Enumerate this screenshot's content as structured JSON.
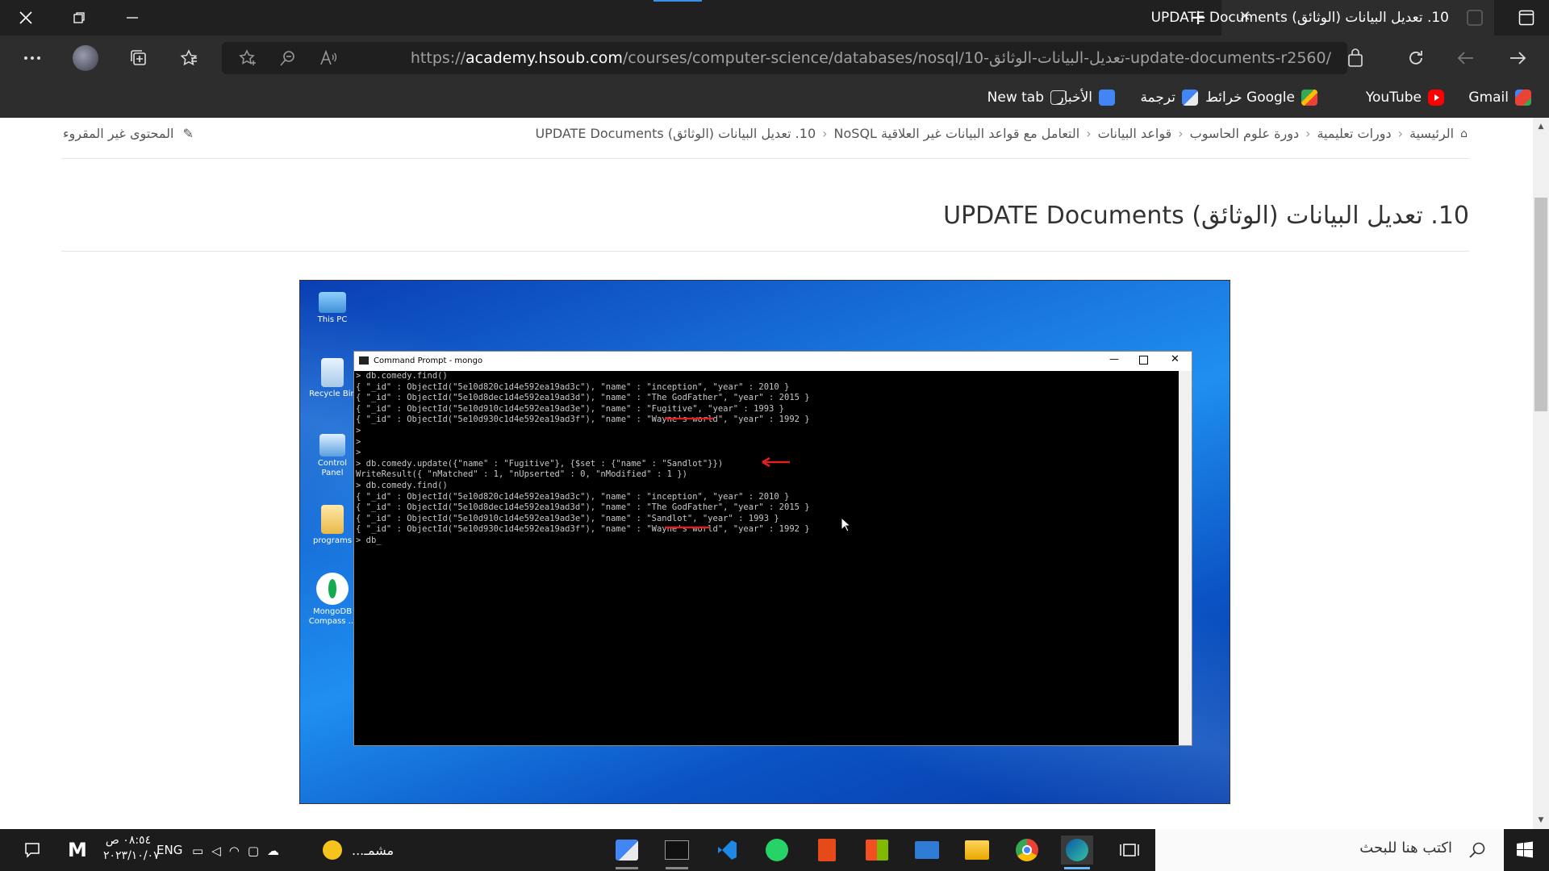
{
  "browser": {
    "tab_title": "10. تعديل البيانات (الوثائق) UPDATE Documents",
    "url_host": "academy.hsoub.com",
    "url_prefix": "https://",
    "url_path": "/courses/computer-science/databases/nosql/10-تعديل-البيانات-الوثائق-update-documents-r2560/",
    "favorites": [
      {
        "label": "Gmail",
        "icon": "gmail-icon",
        "color": "#EA4335"
      },
      {
        "label": "YouTube",
        "icon": "youtube-icon",
        "color": "#FF0000"
      },
      {
        "label": "خرائط Google",
        "icon": "maps-icon",
        "color": "#34A853"
      },
      {
        "label": "ترجمة",
        "icon": "translate-icon",
        "color": "#4285F4"
      },
      {
        "label": "الأخبار",
        "icon": "news-icon",
        "color": "#4285F4"
      },
      {
        "label": "New tab",
        "icon": "newtab-icon",
        "color": "#cccccc"
      }
    ]
  },
  "page": {
    "breadcrumb": [
      "الرئيسية",
      "دورات تعليمية",
      "دورة علوم الحاسوب",
      "قواعد البيانات",
      "التعامل مع قواعد البيانات غير العلاقية NoSQL",
      "10. تعديل البيانات (الوثائق) UPDATE Documents"
    ],
    "unread_label": "المحتوى غير المقروء",
    "heading": "10. تعديل البيانات (الوثائق) UPDATE Documents"
  },
  "screenshot": {
    "desktop_icons": [
      "This PC",
      "Recycle Bin",
      "Control Panel",
      "programs",
      "MongoDB Compass ..."
    ],
    "cmd_title": "Command Prompt - mongo",
    "cmd_lines": [
      "> db.comedy.find()",
      "{ \"_id\" : ObjectId(\"5e10d820c1d4e592ea19ad3c\"), \"name\" : \"inception\", \"year\" : 2010 }",
      "{ \"_id\" : ObjectId(\"5e10d8dec1d4e592ea19ad3d\"), \"name\" : \"The GodFather\", \"year\" : 2015 }",
      "{ \"_id\" : ObjectId(\"5e10d910c1d4e592ea19ad3e\"), \"name\" : \"Fugitive\", \"year\" : 1993 }",
      "{ \"_id\" : ObjectId(\"5e10d930c1d4e592ea19ad3f\"), \"name\" : \"Wayne's world\", \"year\" : 1992 }",
      ">",
      ">",
      ">",
      "> db.comedy.update({\"name\" : \"Fugitive\"}, {$set : {\"name\" : \"Sandlot\"}})",
      "WriteResult({ \"nMatched\" : 1, \"nUpserted\" : 0, \"nModified\" : 1 })",
      "> db.comedy.find()",
      "{ \"_id\" : ObjectId(\"5e10d820c1d4e592ea19ad3c\"), \"name\" : \"inception\", \"year\" : 2010 }",
      "{ \"_id\" : ObjectId(\"5e10d8dec1d4e592ea19ad3d\"), \"name\" : \"The GodFather\", \"year\" : 2015 }",
      "{ \"_id\" : ObjectId(\"5e10d910c1d4e592ea19ad3e\"), \"name\" : \"Sandlot\", \"year\" : 1993 }",
      "{ \"_id\" : ObjectId(\"5e10d930c1d4e592ea19ad3f\"), \"name\" : \"Wayne's world\", \"year\" : 1992 }",
      "> db_"
    ],
    "annotation_color": "#e02020"
  },
  "taskbar": {
    "search_placeholder": "اكتب هنا للبحث",
    "clock_time": "٠٨:٥٤ ص",
    "clock_date": "٢٠٢٣/١٠/٠٧",
    "language": "ENG",
    "weather_label": "مشمـ..."
  }
}
